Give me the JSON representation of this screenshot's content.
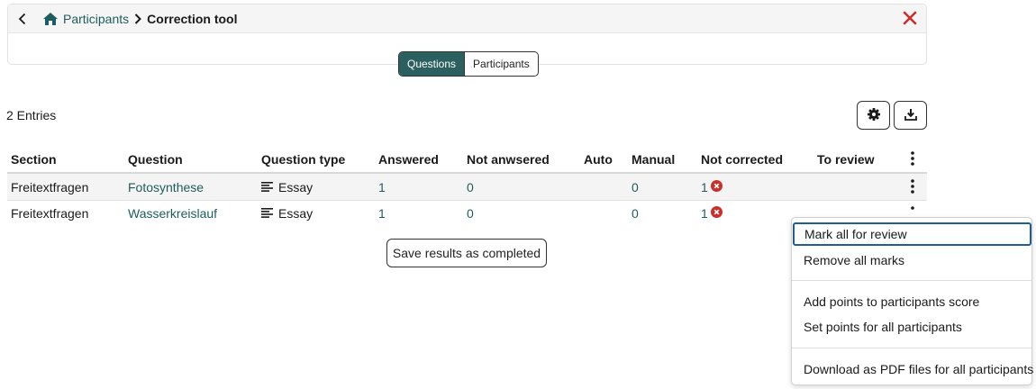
{
  "header": {
    "breadcrumb_parent": "Participants",
    "breadcrumb_current": "Correction tool"
  },
  "view_toggle": {
    "options": [
      "Questions",
      "Participants"
    ],
    "selected": "Questions"
  },
  "entries_count": "2 Entries",
  "toolbar": {
    "settings_icon": "gear-icon",
    "download_icon": "download-icon"
  },
  "table": {
    "columns": [
      "Section",
      "Question",
      "Question type",
      "Answered",
      "Not anwsered",
      "Auto",
      "Manual",
      "Not corrected",
      "To review"
    ],
    "rows": [
      {
        "section": "Freitextfragen",
        "question": "Fotosynthese",
        "type": "Essay",
        "answered": "1",
        "not_answered": "0",
        "auto": "",
        "manual": "0",
        "not_corrected": "1",
        "to_review": ""
      },
      {
        "section": "Freitextfragen",
        "question": "Wasserkreislauf",
        "type": "Essay",
        "answered": "1",
        "not_answered": "0",
        "auto": "",
        "manual": "0",
        "not_corrected": "1",
        "to_review": ""
      }
    ]
  },
  "save_button": "Save results as completed",
  "menu": {
    "items": [
      "Mark all for review",
      "Remove all marks",
      "Add points to participants score",
      "Set points for all participants",
      "Download as PDF files for all participants"
    ]
  },
  "colors": {
    "accent": "#2c5f5f",
    "link": "#1e5d5d",
    "danger": "#c9302c",
    "focus": "#1f5d96"
  }
}
